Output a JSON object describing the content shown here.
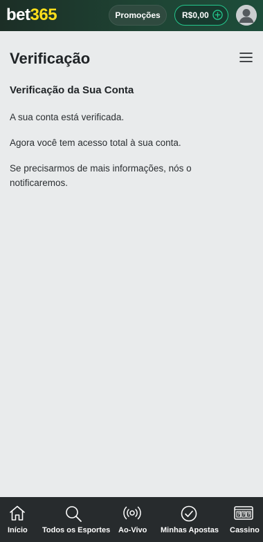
{
  "header": {
    "logo_part1": "bet",
    "logo_part2": "365",
    "promotions_label": "Promoções",
    "balance": "R$0,00"
  },
  "page": {
    "title": "Verificação",
    "section_title": "Verificação da Sua Conta",
    "paragraphs": [
      "A sua conta está verificada.",
      "Agora você tem acesso total à sua conta.",
      "Se precisarmos de mais informações, nós o notificaremos."
    ]
  },
  "bottom_nav": {
    "items": [
      {
        "label": "Início",
        "icon": "home-icon"
      },
      {
        "label": "Todos os Esportes",
        "icon": "search-icon"
      },
      {
        "label": "Ao-Vivo",
        "icon": "live-icon"
      },
      {
        "label": "Minhas Apostas",
        "icon": "check-circle-icon"
      },
      {
        "label": "Cassino",
        "icon": "slot-machine-icon"
      }
    ]
  },
  "colors": {
    "header_bg": "#1e4434",
    "accent_green": "#24c98e",
    "logo_yellow": "#ffdf1b",
    "page_bg": "#e9ebec",
    "nav_bg": "#272b2d"
  }
}
